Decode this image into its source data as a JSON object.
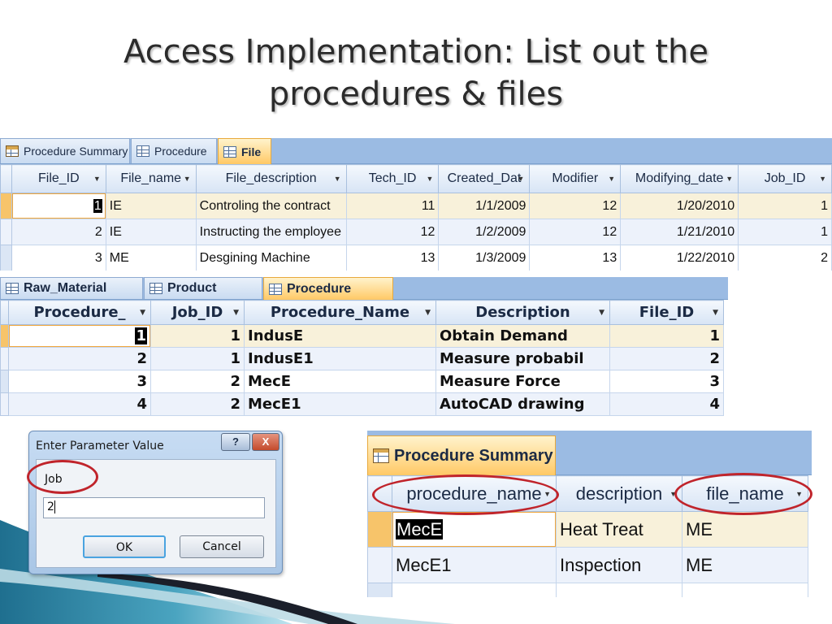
{
  "slide": {
    "title_line1": "Access Implementation: List out the",
    "title_line2": "procedures & files"
  },
  "file_panel": {
    "tabs": [
      {
        "label": "Procedure Summary",
        "icon": "query-icon",
        "active": false
      },
      {
        "label": "Procedure",
        "icon": "table-icon",
        "active": false
      },
      {
        "label": "File",
        "icon": "table-icon",
        "active": true
      }
    ],
    "columns": [
      "File_ID",
      "File_name",
      "File_description",
      "Tech_ID",
      "Created_Dat",
      "Modifier",
      "Modifying_date",
      "Job_ID"
    ],
    "rows": [
      [
        "1",
        "IE",
        "Controling the contract",
        "11",
        "1/1/2009",
        "12",
        "1/20/2010",
        "1"
      ],
      [
        "2",
        "IE",
        "Instructing the employee",
        "12",
        "1/2/2009",
        "12",
        "1/21/2010",
        "1"
      ],
      [
        "3",
        "ME",
        "Desgining Machine",
        "13",
        "1/3/2009",
        "13",
        "1/22/2010",
        "2"
      ]
    ]
  },
  "procedure_panel": {
    "tabs": [
      {
        "label": "Raw_Material",
        "icon": "table-icon",
        "active": false
      },
      {
        "label": "Product",
        "icon": "table-icon",
        "active": false
      },
      {
        "label": "Procedure",
        "icon": "table-icon",
        "active": true
      }
    ],
    "columns": [
      "Procedure_",
      "Job_ID",
      "Procedure_Name",
      "Description",
      "File_ID"
    ],
    "rows": [
      [
        "1",
        "1",
        "IndusE",
        "Obtain Demand",
        "1"
      ],
      [
        "2",
        "1",
        "IndusE1",
        "Measure probabil",
        "2"
      ],
      [
        "3",
        "2",
        "MecE",
        "Measure Force",
        "3"
      ],
      [
        "4",
        "2",
        "MecE1",
        "AutoCAD drawing",
        "4"
      ]
    ]
  },
  "dialog": {
    "title": "Enter Parameter Value",
    "help_label": "?",
    "close_label": "X",
    "param_label": "Job",
    "param_value": "2",
    "ok_label": "OK",
    "cancel_label": "Cancel"
  },
  "summary_panel": {
    "tab": {
      "label": "Procedure Summary",
      "icon": "query-icon",
      "active": true
    },
    "columns": [
      "procedure_name",
      "description",
      "file_name"
    ],
    "rows": [
      [
        "MecE",
        "Heat Treat",
        "ME"
      ],
      [
        "MecE1",
        "Inspection",
        "ME"
      ]
    ]
  },
  "colors": {
    "tabbar": "#9bbbe3",
    "active_tab": "#ffc966",
    "highlight_ring": "#c0242b",
    "swoosh_dark": "#1b1f2a",
    "swoosh_teal": "#2a7c9a"
  }
}
